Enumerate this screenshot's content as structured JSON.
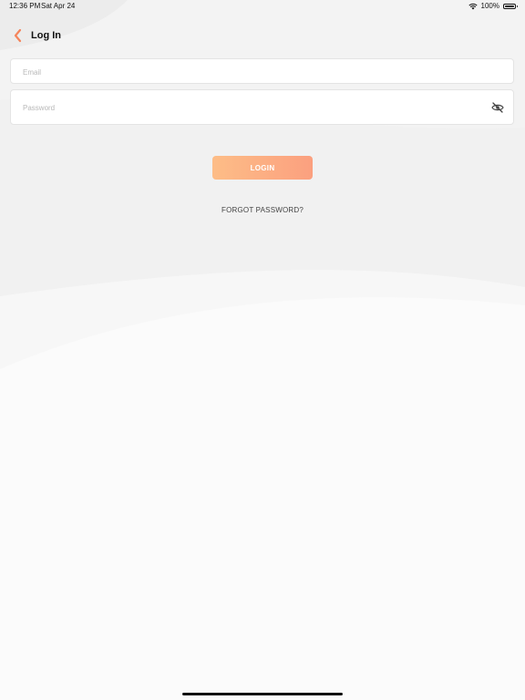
{
  "status_bar": {
    "time": "12:36 PM",
    "date": "Sat Apr 24",
    "battery": "100%",
    "icons": [
      "wifi-icon",
      "battery-icon"
    ]
  },
  "nav": {
    "back_icon": "chevron-left-icon",
    "title": "Log In"
  },
  "form": {
    "email_placeholder": "Email",
    "email_value": "",
    "password_placeholder": "Password",
    "password_value": "",
    "password_toggle_icon": "eye-slash-icon",
    "login_label": "LOGIN",
    "forgot_label": "FORGOT PASSWORD?"
  },
  "colors": {
    "accent": "#f5845b",
    "button_gradient_start": "#fdbd87",
    "button_gradient_end": "#fba07f",
    "background": "#f5f5f5"
  }
}
